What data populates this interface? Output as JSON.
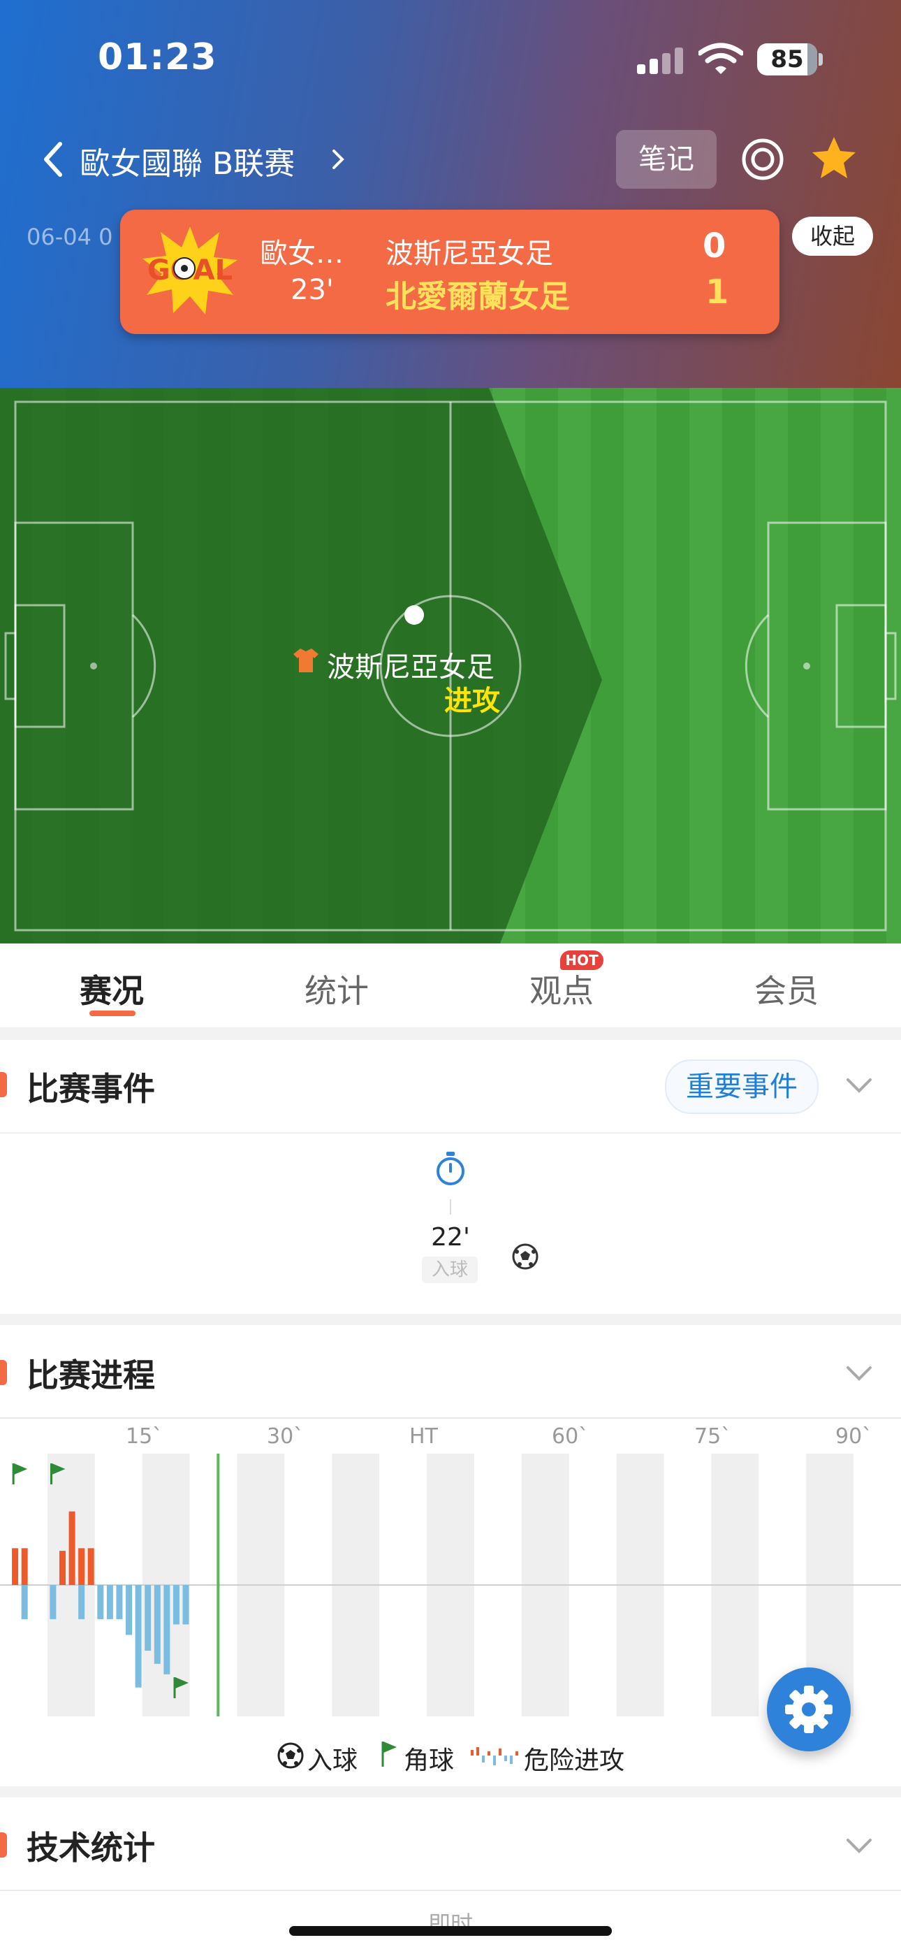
{
  "status": {
    "time": "01:23",
    "battery": "85"
  },
  "header": {
    "league": "歐女國聯 B联赛",
    "notes_label": "笔记",
    "date_partial": "06-04 0",
    "collapse_label": "收起"
  },
  "goal_toast": {
    "badge_text": "GOAL",
    "league": "歐女…",
    "minute": "23'",
    "home_team": "波斯尼亞女足",
    "away_team": "北愛爾蘭女足",
    "home_score": "0",
    "away_score": "1"
  },
  "pitch": {
    "team": "波斯尼亞女足",
    "state": "进攻"
  },
  "tabs": [
    {
      "label": "赛况",
      "active": true
    },
    {
      "label": "统计",
      "active": false
    },
    {
      "label": "观点",
      "active": false,
      "badge": "HOT"
    },
    {
      "label": "会员",
      "active": false
    }
  ],
  "events_section": {
    "title": "比赛事件",
    "important_label": "重要事件",
    "event": {
      "minute": "22'",
      "type": "入球"
    }
  },
  "progress_section": {
    "title": "比赛进程",
    "ticks": [
      "15`",
      "30`",
      "HT",
      "60`",
      "75`",
      "90`"
    ],
    "current_minute": 23,
    "home_attacks": [
      {
        "minute": 1,
        "level": 0.28
      },
      {
        "minute": 2,
        "level": 0.28
      },
      {
        "minute": 6,
        "level": 0.26
      },
      {
        "minute": 7,
        "level": 0.56
      },
      {
        "minute": 8,
        "level": 0.28
      },
      {
        "minute": 9,
        "level": 0.28
      }
    ],
    "away_attacks": [
      {
        "minute": 2,
        "level": 0.26
      },
      {
        "minute": 5,
        "level": 0.26
      },
      {
        "minute": 8,
        "level": 0.26
      },
      {
        "minute": 10,
        "level": 0.26
      },
      {
        "minute": 11,
        "level": 0.26
      },
      {
        "minute": 12,
        "level": 0.26
      },
      {
        "minute": 13,
        "level": 0.38
      },
      {
        "minute": 14,
        "level": 0.78
      },
      {
        "minute": 15,
        "level": 0.5
      },
      {
        "minute": 16,
        "level": 0.6
      },
      {
        "minute": 17,
        "level": 0.68
      },
      {
        "minute": 18,
        "level": 0.3
      },
      {
        "minute": 19,
        "level": 0.3
      }
    ],
    "home_corners": [
      2,
      6
    ],
    "away_corners": [
      19
    ],
    "legend": {
      "goal": "入球",
      "corner": "角球",
      "danger": "危险进攻"
    }
  },
  "tech_section": {
    "title": "技术统计",
    "sub": "即时"
  },
  "colors": {
    "accent": "#f36a44",
    "home": "#ef5a2a",
    "away": "#7bbde0",
    "pitch": "#3a9a35"
  }
}
